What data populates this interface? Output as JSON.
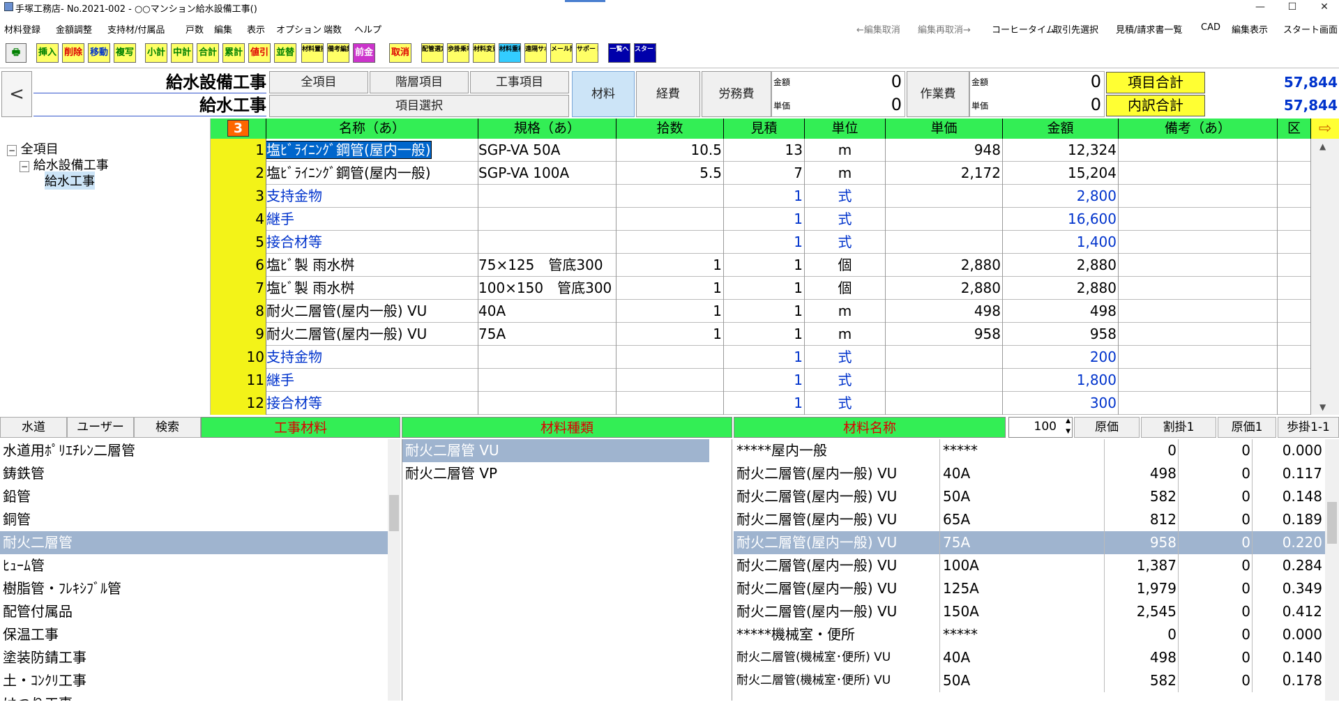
{
  "window": {
    "title": "手塚工務店- No.2021-002 - ○○マンション給水設備工事()",
    "minimize": "—",
    "maximize": "☐",
    "close": "✕"
  },
  "menu": {
    "left": [
      "材料登録",
      "金額調整",
      "支持材/付属品",
      "戸数",
      "編集",
      "表示",
      "オプション",
      "端数",
      "ヘルプ"
    ],
    "right": [
      {
        "label": "←編集取消",
        "dim": true
      },
      {
        "label": "編集再取消→",
        "dim": true
      },
      {
        "label": "コーヒータイム",
        "dim": false
      },
      {
        "label": "取引先選択",
        "dim": false
      },
      {
        "label": "見積/請求書一覧",
        "dim": false
      },
      {
        "label": "CAD",
        "dim": false
      },
      {
        "label": "編集表示",
        "dim": false
      },
      {
        "label": "スタート画面",
        "dim": false
      }
    ]
  },
  "toolbar": {
    "insert": "挿入",
    "delete": "削除",
    "move": "移動",
    "copy": "複写",
    "subtotal": "小計",
    "midtotal": "中計",
    "total": "合計",
    "cumulative": "累計",
    "discount": "値引",
    "sort": "並替",
    "material_replace": "材料置換",
    "note_edit": "備考編集",
    "prepay": "前金",
    "cancel": "取消",
    "pipe_select": "配管選定",
    "step_rate": "歩掛乗率",
    "material_change": "材料変更",
    "material_register": "材料重複",
    "remote_support": "遠隔サポート",
    "mail_contact": "メール問合せ",
    "support_site": "サポートサイト",
    "list": "一覧へ",
    "start": "スタート画面"
  },
  "header": {
    "title1": "給水設備工事",
    "title2": "給水工事",
    "back": "<",
    "all_items": "全項目",
    "floor_items": "階層項目",
    "work_items": "工事項目",
    "item_select": "項目選択",
    "tab_material": "材料",
    "tab_expense": "経費",
    "tab_labor": "労務費",
    "amount_label": "金額",
    "unit_label": "単価",
    "mat_amount": "0",
    "mat_unit": "0",
    "work_fee": "作業費",
    "work_amount": "0",
    "work_unit": "0",
    "item_total_label": "項目合計",
    "item_total": "57,844",
    "detail_total_label": "内訳合計",
    "detail_total": "57,844"
  },
  "tree": {
    "root": "全項目",
    "child": "給水設備工事",
    "leaf": "給水工事"
  },
  "grid": {
    "corner": "3",
    "columns": [
      "名称（あ）",
      "規格（あ）",
      "拾数",
      "見積",
      "単位",
      "単価",
      "金額",
      "備考（あ）",
      "区"
    ],
    "rows": [
      {
        "no": "1",
        "name": "塩ﾋﾞﾗｲﾆﾝｸﾞ鋼管(屋内一般)",
        "spec": "SGP-VA 50A",
        "count": "10.5",
        "est": "13",
        "unit": "m",
        "price": "948",
        "amount": "12,324",
        "blue": false,
        "selected": true
      },
      {
        "no": "2",
        "name": "塩ﾋﾞﾗｲﾆﾝｸﾞ鋼管(屋内一般)",
        "spec": "SGP-VA 100A",
        "count": "5.5",
        "est": "7",
        "unit": "m",
        "price": "2,172",
        "amount": "15,204",
        "blue": false,
        "selected": false
      },
      {
        "no": "3",
        "name": "支持金物",
        "spec": "",
        "count": "",
        "est": "1",
        "unit": "式",
        "price": "",
        "amount": "2,800",
        "blue": true,
        "selected": false
      },
      {
        "no": "4",
        "name": "継手",
        "spec": "",
        "count": "",
        "est": "1",
        "unit": "式",
        "price": "",
        "amount": "16,600",
        "blue": true,
        "selected": false
      },
      {
        "no": "5",
        "name": "接合材等",
        "spec": "",
        "count": "",
        "est": "1",
        "unit": "式",
        "price": "",
        "amount": "1,400",
        "blue": true,
        "selected": false
      },
      {
        "no": "6",
        "name": "塩ﾋﾞ製 雨水桝",
        "spec": "75×125　管底300",
        "count": "1",
        "est": "1",
        "unit": "個",
        "price": "2,880",
        "amount": "2,880",
        "blue": false,
        "selected": false
      },
      {
        "no": "7",
        "name": "塩ﾋﾞ製 雨水桝",
        "spec": "100×150　管底300",
        "count": "1",
        "est": "1",
        "unit": "個",
        "price": "2,880",
        "amount": "2,880",
        "blue": false,
        "selected": false
      },
      {
        "no": "8",
        "name": "耐火二層管(屋内一般) VU",
        "spec": "40A",
        "count": "1",
        "est": "1",
        "unit": "m",
        "price": "498",
        "amount": "498",
        "blue": false,
        "selected": false
      },
      {
        "no": "9",
        "name": "耐火二層管(屋内一般) VU",
        "spec": "75A",
        "count": "1",
        "est": "1",
        "unit": "m",
        "price": "958",
        "amount": "958",
        "blue": false,
        "selected": false
      },
      {
        "no": "10",
        "name": "支持金物",
        "spec": "",
        "count": "",
        "est": "1",
        "unit": "式",
        "price": "",
        "amount": "200",
        "blue": true,
        "selected": false
      },
      {
        "no": "11",
        "name": "継手",
        "spec": "",
        "count": "",
        "est": "1",
        "unit": "式",
        "price": "",
        "amount": "1,800",
        "blue": true,
        "selected": false
      },
      {
        "no": "12",
        "name": "接合材等",
        "spec": "",
        "count": "",
        "est": "1",
        "unit": "式",
        "price": "",
        "amount": "300",
        "blue": true,
        "selected": false
      }
    ]
  },
  "bottom": {
    "tab_water": "水道",
    "tab_user": "ユーザー",
    "tab_search": "検索",
    "hdr_work_material": "工事材料",
    "hdr_material_type": "材料種類",
    "hdr_material_name": "材料名称",
    "rate_value": "100",
    "col_cost": "原価",
    "col_discount": "割掛1",
    "col_cost1": "原価1",
    "col_step": "歩掛1-1",
    "categories": [
      "水道用ﾎﾟﾘｴﾁﾚﾝ二層管",
      "鋳鉄管",
      "鉛管",
      "銅管",
      "耐火二層管",
      "ﾋｭｰﾑ管",
      "樹脂管・ﾌﾚｷｼﾌﾞﾙ管",
      "配管付属品",
      "保温工事",
      "塗装防錆工事",
      "土・ｺﾝｸﾘ工事",
      "はつり工事"
    ],
    "selected_category": 4,
    "types": [
      "耐火二層管 VU",
      "耐火二層管 VP"
    ],
    "selected_type": 0,
    "materials": [
      {
        "name": "*****屋内一般",
        "spec": "*****",
        "cost": "0",
        "cost1": "0",
        "step": "0.000"
      },
      {
        "name": "耐火二層管(屋内一般) VU",
        "spec": "40A",
        "cost": "498",
        "cost1": "0",
        "step": "0.117"
      },
      {
        "name": "耐火二層管(屋内一般) VU",
        "spec": "50A",
        "cost": "582",
        "cost1": "0",
        "step": "0.148"
      },
      {
        "name": "耐火二層管(屋内一般) VU",
        "spec": "65A",
        "cost": "812",
        "cost1": "0",
        "step": "0.189"
      },
      {
        "name": "耐火二層管(屋内一般) VU",
        "spec": "75A",
        "cost": "958",
        "cost1": "0",
        "step": "0.220"
      },
      {
        "name": "耐火二層管(屋内一般) VU",
        "spec": "100A",
        "cost": "1,387",
        "cost1": "0",
        "step": "0.284"
      },
      {
        "name": "耐火二層管(屋内一般) VU",
        "spec": "125A",
        "cost": "1,979",
        "cost1": "0",
        "step": "0.349"
      },
      {
        "name": "耐火二層管(屋内一般) VU",
        "spec": "150A",
        "cost": "2,545",
        "cost1": "0",
        "step": "0.412"
      },
      {
        "name": "*****機械室・便所",
        "spec": "*****",
        "cost": "0",
        "cost1": "0",
        "step": "0.000"
      },
      {
        "name": "耐火二層管(機械室･便所) VU",
        "spec": "40A",
        "cost": "498",
        "cost1": "0",
        "step": "0.140"
      },
      {
        "name": "耐火二層管(機械室･便所) VU",
        "spec": "50A",
        "cost": "582",
        "cost1": "0",
        "step": "0.178"
      }
    ],
    "selected_material": 4
  }
}
